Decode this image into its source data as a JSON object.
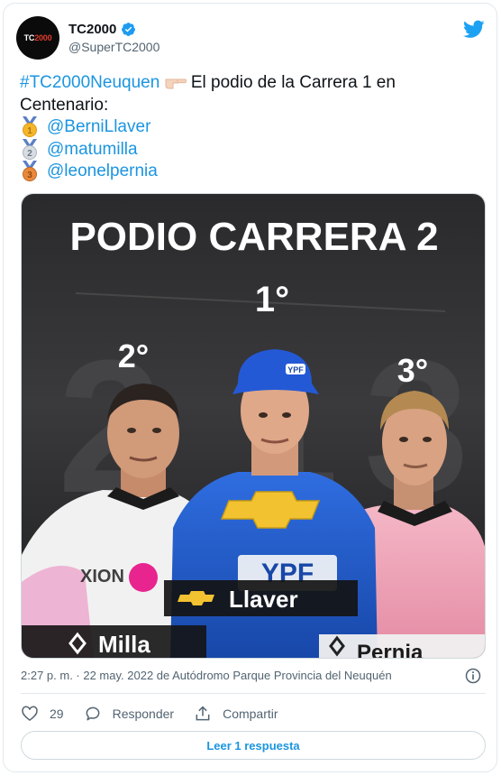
{
  "account": {
    "display_name": "TC2000",
    "handle": "@SuperTC2000",
    "avatar_text_a": "TC",
    "avatar_text_b": "2000"
  },
  "tweet": {
    "hashtag": "#TC2000Neuquen",
    "text_after_hashtag": " El podio de la Carrera 1 en Centenario:",
    "mentions": [
      "@BerniLlaver",
      "@matumilla",
      "@leonelpernia"
    ],
    "medal_numbers": [
      "1",
      "2",
      "3"
    ]
  },
  "media": {
    "headline": "PODIO CARRERA 2",
    "positions": {
      "first": "1°",
      "second": "2°",
      "third": "3°"
    },
    "driver_names": {
      "first": "Llaver",
      "second": "Milla",
      "third": "Pernia"
    },
    "cap_text": "YPF",
    "sponsor_text": "YPF"
  },
  "meta": {
    "timestamp": "2:27 p. m. · 22 may. 2022 de Autódromo Parque Provincia del Neuquén"
  },
  "actions": {
    "like_count": "29",
    "reply_label": "Responder",
    "share_label": "Compartir"
  },
  "read_replies_label": "Leer 1 respuesta",
  "colors": {
    "link": "#1b95e0",
    "muted": "#536471",
    "text": "#0f1419",
    "border": "#e1e8ed",
    "verified": "#1d9bf0",
    "twitter": "#1da1f2"
  },
  "icons": [
    "verified-badge-icon",
    "twitter-bird-icon",
    "medal-1-icon",
    "medal-2-icon",
    "medal-3-icon",
    "pointing-hand-icon",
    "info-icon",
    "heart-icon",
    "reply-icon",
    "share-icon",
    "chevrolet-logo-icon",
    "renault-logo-icon"
  ]
}
